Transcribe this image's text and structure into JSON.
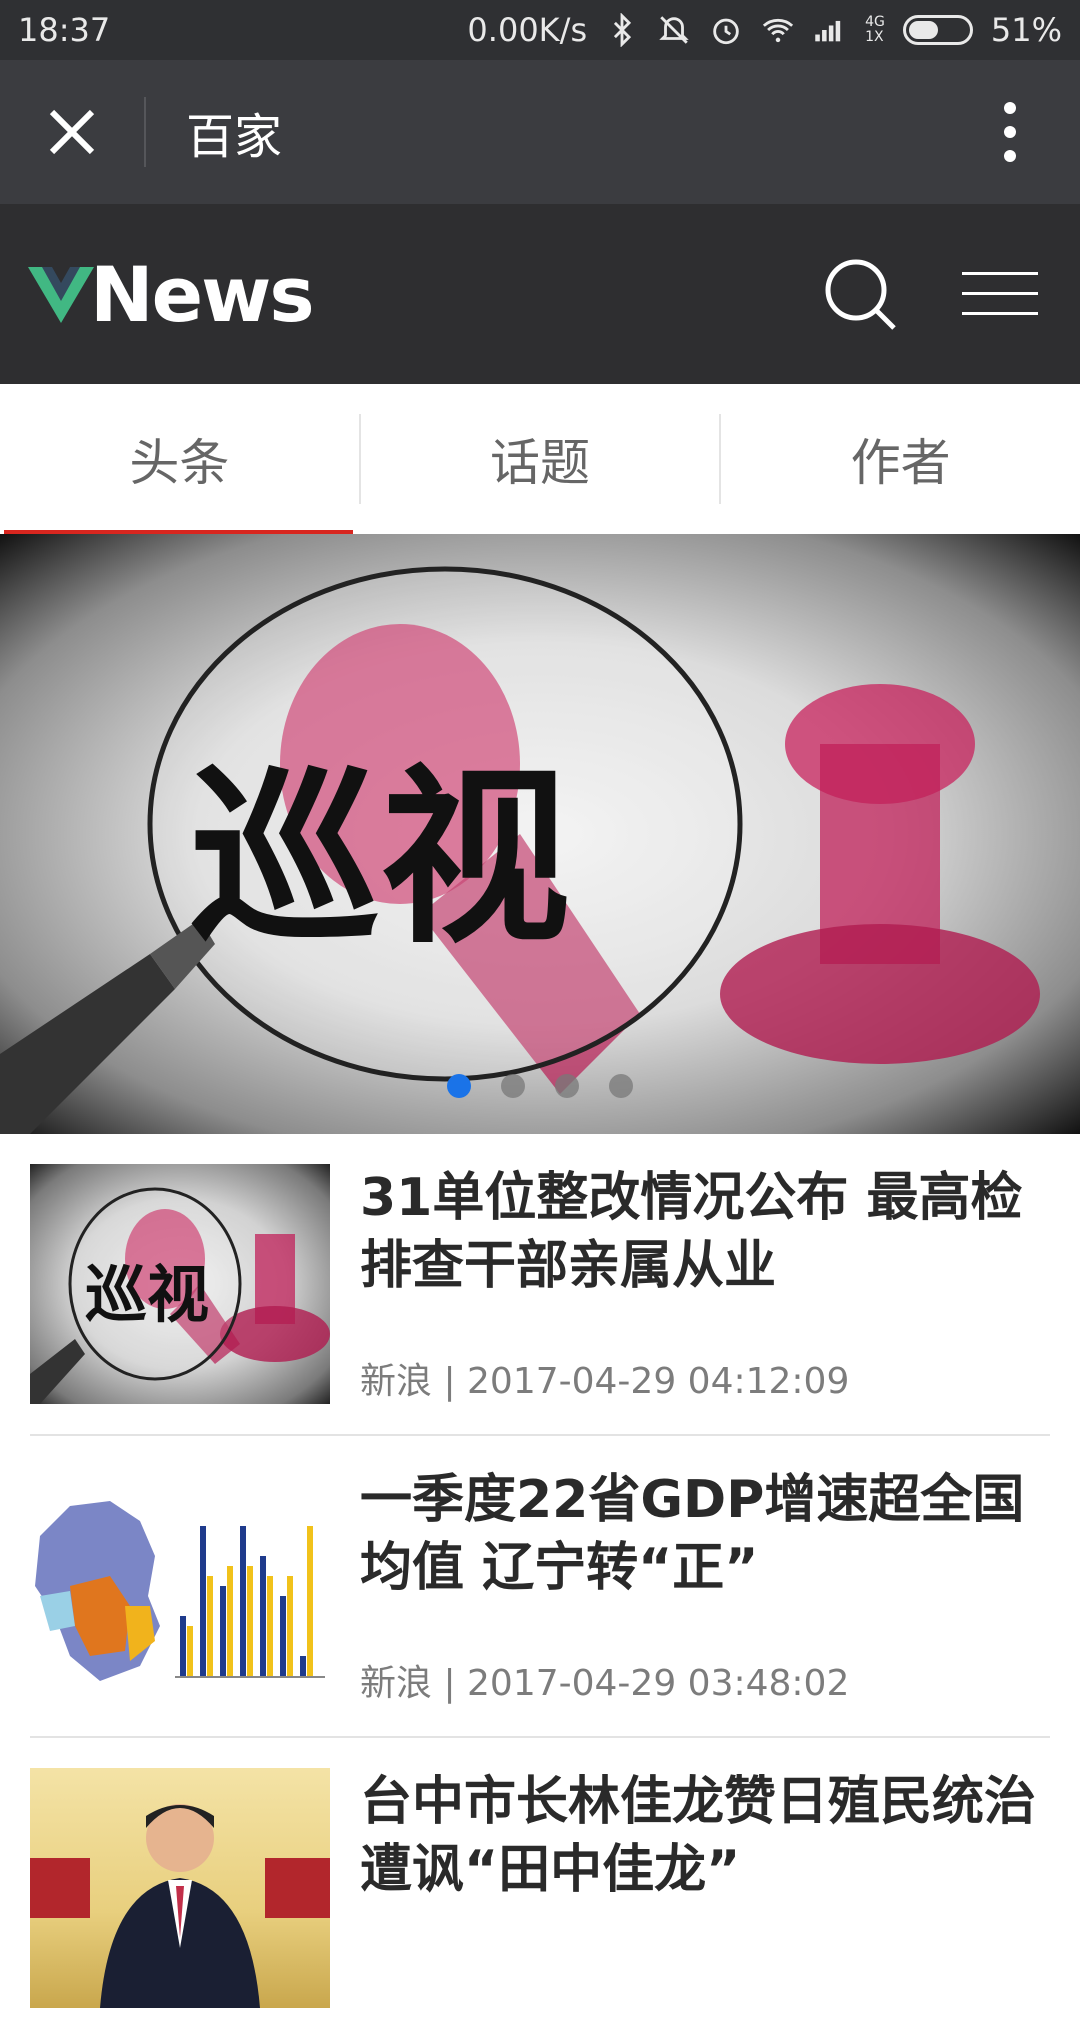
{
  "status_bar": {
    "time": "18:37",
    "net_speed": "0.00K/s",
    "network_top": "4G",
    "network_bottom": "1X",
    "battery": "51%",
    "battery_level": 0.51
  },
  "top_bar": {
    "title": "百家"
  },
  "header": {
    "logo_text": "News",
    "logo_accent_color": "#41b883"
  },
  "tabs": [
    {
      "label": "头条",
      "active": true
    },
    {
      "label": "话题",
      "active": false
    },
    {
      "label": "作者",
      "active": false
    }
  ],
  "carousel": {
    "image_text": "巡视",
    "slide_count": 4,
    "active_index": 0
  },
  "news": [
    {
      "title": "31单位整改情况公布 最高检排查干部亲属从业",
      "meta": "新浪 | 2017-04-29 04:12:09",
      "thumb_text": "巡视"
    },
    {
      "title": "一季度22省GDP增速超全国均值 辽宁转“正”",
      "meta": "新浪 | 2017-04-29 03:48:02"
    },
    {
      "title": "台中市长林佳龙赞日殖民统治 遭讽“田中佳龙”",
      "meta": ""
    }
  ]
}
